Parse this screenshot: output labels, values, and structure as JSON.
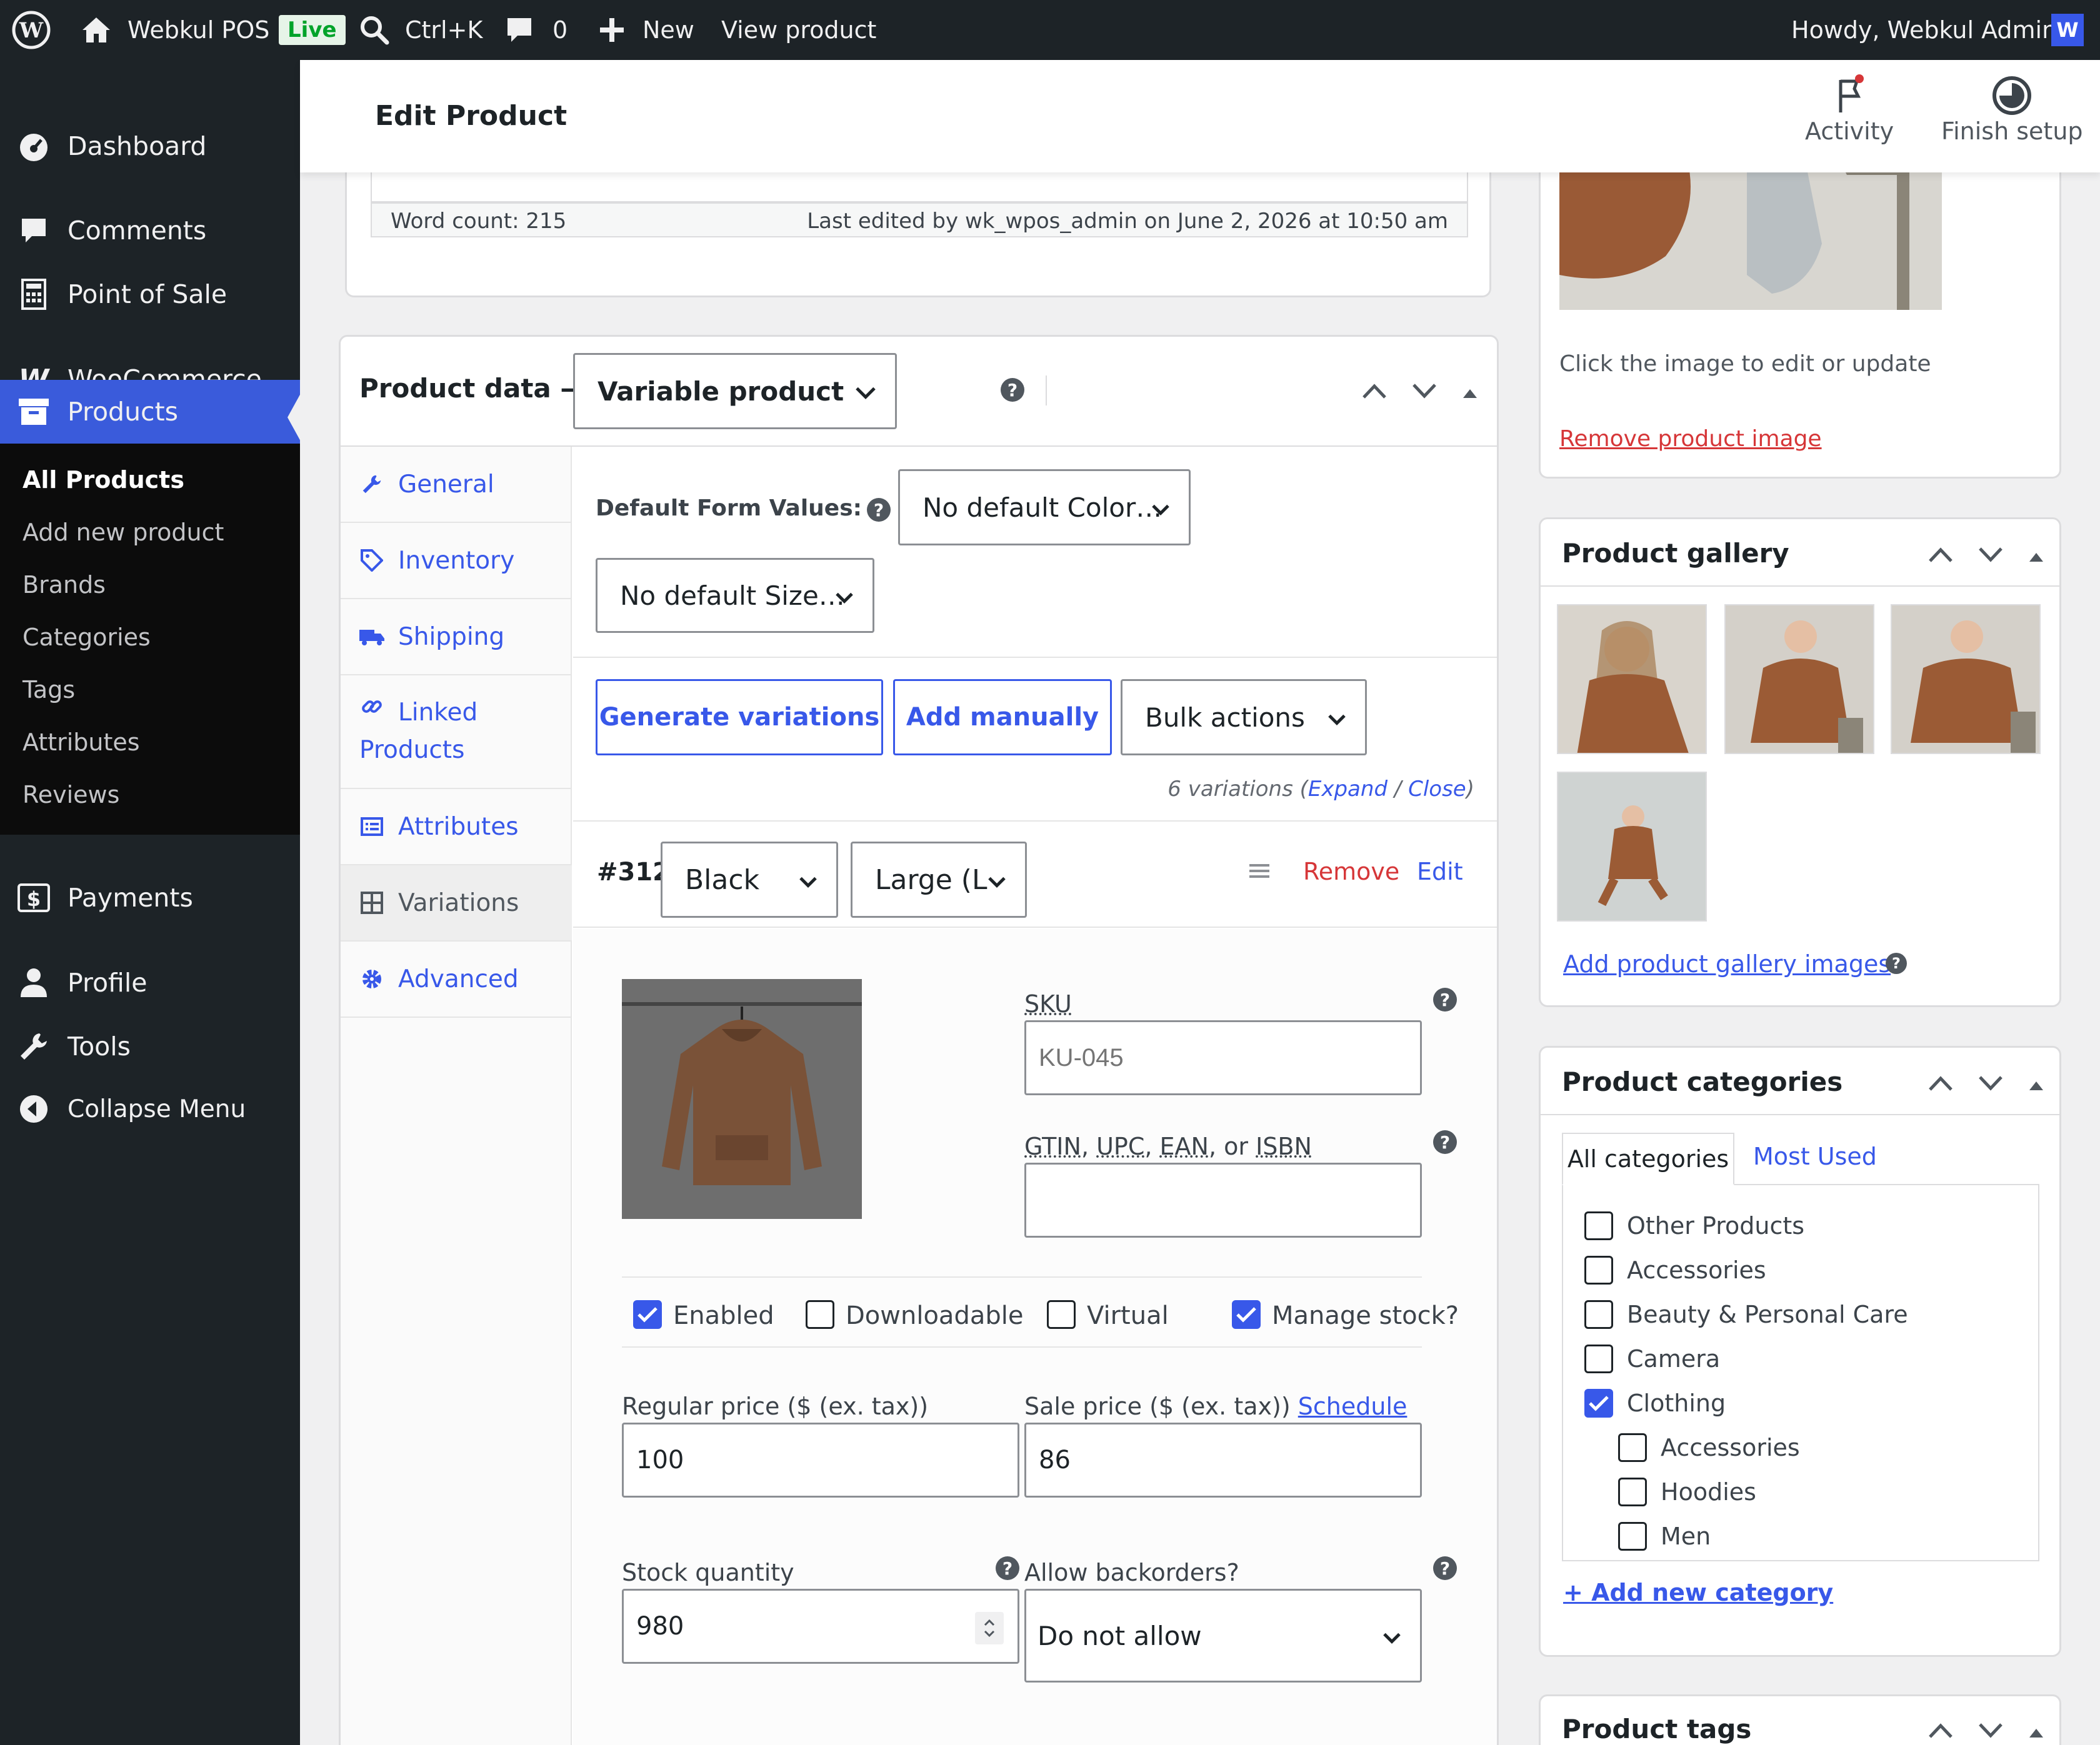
{
  "adminbar": {
    "site_name": "Webkul POS",
    "live_badge": "Live",
    "search_shortcut": "Ctrl+K",
    "comments_count": "0",
    "new_label": "New",
    "view_product": "View product",
    "howdy": "Howdy, Webkul Admin"
  },
  "sidebar": {
    "dashboard": "Dashboard",
    "comments": "Comments",
    "pos": "Point of Sale",
    "woocommerce": "WooCommerce",
    "products": "Products",
    "sub": [
      "All Products",
      "Add new product",
      "Brands",
      "Categories",
      "Tags",
      "Attributes",
      "Reviews"
    ],
    "payments": "Payments",
    "profile": "Profile",
    "tools": "Tools",
    "collapse": "Collapse Menu"
  },
  "header": {
    "title": "Edit Product",
    "activity": "Activity",
    "finish_setup": "Finish setup"
  },
  "editor_footer": {
    "word_count": "Word count: 215",
    "last_edited": "Last edited by wk_wpos_admin on June 2, 2026 at 10:50 am"
  },
  "product_data": {
    "label": "Product data —",
    "type_value": "Variable product",
    "tabs": [
      "General",
      "Inventory",
      "Shipping",
      "Linked Products",
      "Attributes",
      "Variations",
      "Advanced"
    ],
    "default_form_values": "Default Form Values:",
    "default_color": "No default Color…",
    "default_size": "No default Size…",
    "generate_variations": "Generate variations",
    "add_manually": "Add manually",
    "bulk_actions": "Bulk actions",
    "variations_count": "6 variations (",
    "expand": "Expand",
    "slash": " / ",
    "close": "Close",
    "close_paren": ")",
    "variation": {
      "id": "#312",
      "color": "Black",
      "size": "Large (L",
      "remove": "Remove",
      "edit": "Edit",
      "sku_label": "SKU",
      "sku_placeholder": "KU-045",
      "gtin_label_parts": [
        "GTIN",
        ", ",
        "UPC",
        ", ",
        "EAN",
        ", or ",
        "ISBN"
      ],
      "enabled": "Enabled",
      "downloadable": "Downloadable",
      "virtual": "Virtual",
      "manage_stock": "Manage stock?",
      "regular_price_label": "Regular price ($ (ex. tax))",
      "regular_price": "100",
      "sale_price_label": "Sale price ($ (ex. tax))",
      "schedule": "Schedule",
      "sale_price": "86",
      "stock_qty_label": "Stock quantity",
      "stock_qty": "980",
      "backorders_label": "Allow backorders?",
      "backorders_value": "Do not allow",
      "checkboxes": {
        "enabled": true,
        "downloadable": false,
        "virtual": false,
        "manage_stock": true
      }
    }
  },
  "product_image": {
    "hint": "Click the image to edit or update",
    "remove": "Remove product image"
  },
  "gallery": {
    "title": "Product gallery",
    "add_link": "Add product gallery images"
  },
  "categories": {
    "title": "Product categories",
    "tab_all": "All categories",
    "tab_most_used": "Most Used",
    "items": [
      {
        "label": "Other Products",
        "checked": false,
        "child": false
      },
      {
        "label": "Accessories",
        "checked": false,
        "child": false
      },
      {
        "label": "Beauty & Personal Care",
        "checked": false,
        "child": false
      },
      {
        "label": "Camera",
        "checked": false,
        "child": false
      },
      {
        "label": "Clothing",
        "checked": true,
        "child": false
      },
      {
        "label": "Accessories",
        "checked": false,
        "child": true
      },
      {
        "label": "Hoodies",
        "checked": false,
        "child": true
      },
      {
        "label": "Men",
        "checked": false,
        "child": true
      }
    ],
    "add_new": "+ Add new category"
  },
  "tags": {
    "title": "Product tags"
  },
  "colors": {
    "accent": "#3858e9",
    "adminbar": "#1d2327",
    "danger": "#d63638"
  }
}
